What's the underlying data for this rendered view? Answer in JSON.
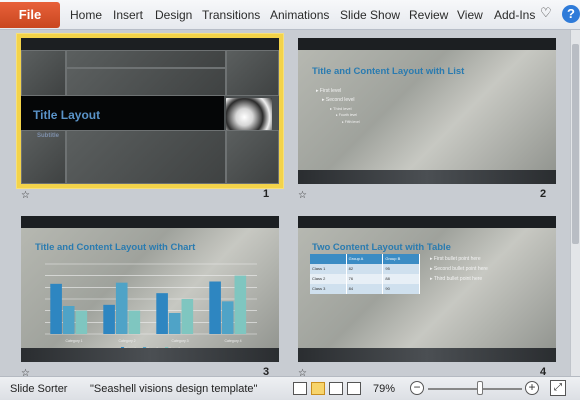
{
  "ribbon": {
    "file_label": "File",
    "tabs": [
      "Home",
      "Insert",
      "Design",
      "Transitions",
      "Animations",
      "Slide Show",
      "Review",
      "View",
      "Add-Ins"
    ],
    "help_label": "?",
    "heart_glyph": "♡"
  },
  "slides": [
    {
      "number": "1",
      "title": "Title Layout",
      "subtitle": "Subtitle",
      "selected": true
    },
    {
      "number": "2",
      "title": "Title and Content Layout with List",
      "bullets": [
        "First level",
        "Second level",
        "Third level",
        "Fourth level",
        "Fifth level"
      ]
    },
    {
      "number": "3",
      "title": "Title and Content Layout with Chart",
      "chart_data": {
        "type": "bar",
        "categories": [
          "Category 1",
          "Category 2",
          "Category 3",
          "Category 4"
        ],
        "series": [
          {
            "name": "Series 1",
            "values": [
              4.3,
              2.5,
              3.5,
              4.5
            ]
          },
          {
            "name": "Series 2",
            "values": [
              2.4,
              4.4,
              1.8,
              2.8
            ]
          },
          {
            "name": "Series 3",
            "values": [
              2.0,
              2.0,
              3.0,
              5.0
            ]
          }
        ],
        "ylim": [
          0,
          6
        ],
        "colors": [
          "#2e86c1",
          "#4fa3c7",
          "#7fc6c0"
        ]
      }
    },
    {
      "number": "4",
      "title": "Two Content Layout with Table",
      "table": {
        "headers": [
          "",
          "Group A",
          "Group B"
        ],
        "rows": [
          [
            "Class 1",
            "82",
            "95"
          ],
          [
            "Class 2",
            "76",
            "88"
          ],
          [
            "Class 3",
            "84",
            "90"
          ]
        ]
      },
      "bullets": [
        "First bullet point here",
        "Second bullet point here",
        "Third bullet point here"
      ]
    }
  ],
  "star_glyph": "☆",
  "status": {
    "view_name": "Slide Sorter",
    "theme": "\"Seashell visions design template\"",
    "zoom": "79%",
    "zoom_level": 0.55,
    "minus": "−",
    "plus": "+"
  }
}
